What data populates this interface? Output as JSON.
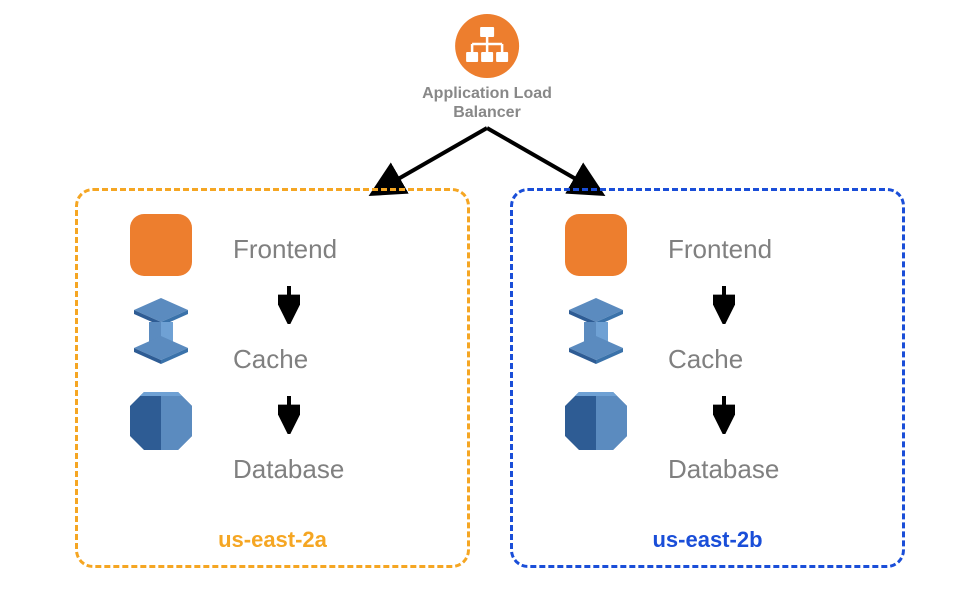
{
  "load_balancer": {
    "label_line1": "Application Load",
    "label_line2": "Balancer"
  },
  "tiers": {
    "frontend": "Frontend",
    "cache": "Cache",
    "database": "Database"
  },
  "zones": {
    "a": {
      "name": "us-east-2a",
      "color": "#f5a623"
    },
    "b": {
      "name": "us-east-2b",
      "color": "#1a4ed8"
    }
  },
  "colors": {
    "aws_orange": "#ed7e2e",
    "aws_blue_light": "#5b8bbf",
    "aws_blue_dark": "#2e5c94",
    "text_gray": "#808080"
  }
}
